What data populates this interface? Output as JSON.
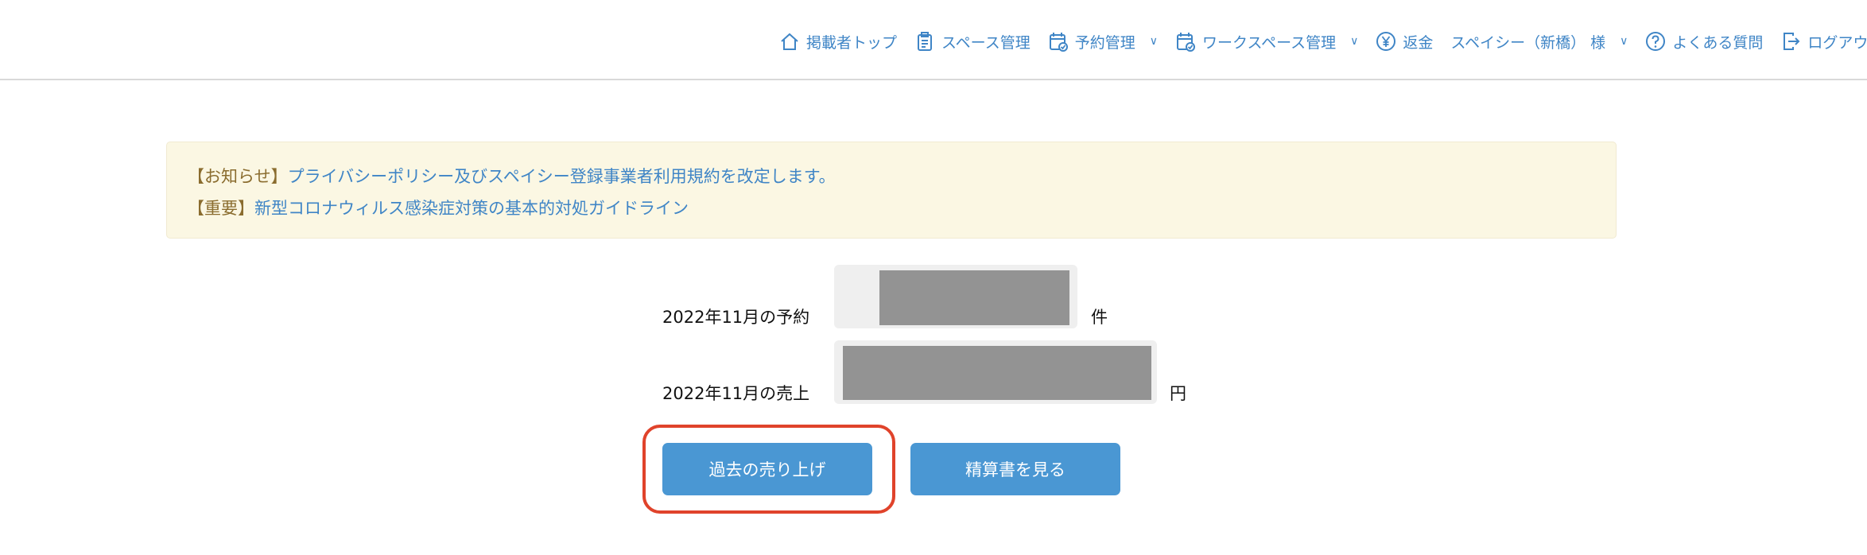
{
  "header": {
    "nav": {
      "host_top": "掲載者トップ",
      "space_manage": "スペース管理",
      "reservation_manage": "予約管理",
      "workspace_manage": "ワークスペース管理",
      "refund": "返金",
      "user_name": "スペイシー（新橋） 様",
      "faq": "よくある質問",
      "logout": "ログアウト",
      "chevron": "∨"
    }
  },
  "notices": [
    {
      "tag": "【お知らせ】",
      "text": "プライバシーポリシー及びスペイシー登録事業者利用規約を改定します。"
    },
    {
      "tag": "【重要】",
      "text": "新型コロナウィルス感染症対策の基本的対処ガイドライン"
    }
  ],
  "stats": {
    "reservations": {
      "label": "2022年11月の予約",
      "unit": "件"
    },
    "sales": {
      "label": "2022年11月の売上",
      "unit": "円"
    }
  },
  "buttons": {
    "past_sales": "過去の売り上げ",
    "view_statement": "精算書を見る"
  },
  "colors": {
    "link": "#3f85c6",
    "button": "#4a97d3",
    "notice_bg": "#fbf7e3",
    "highlight": "#e0432b"
  }
}
